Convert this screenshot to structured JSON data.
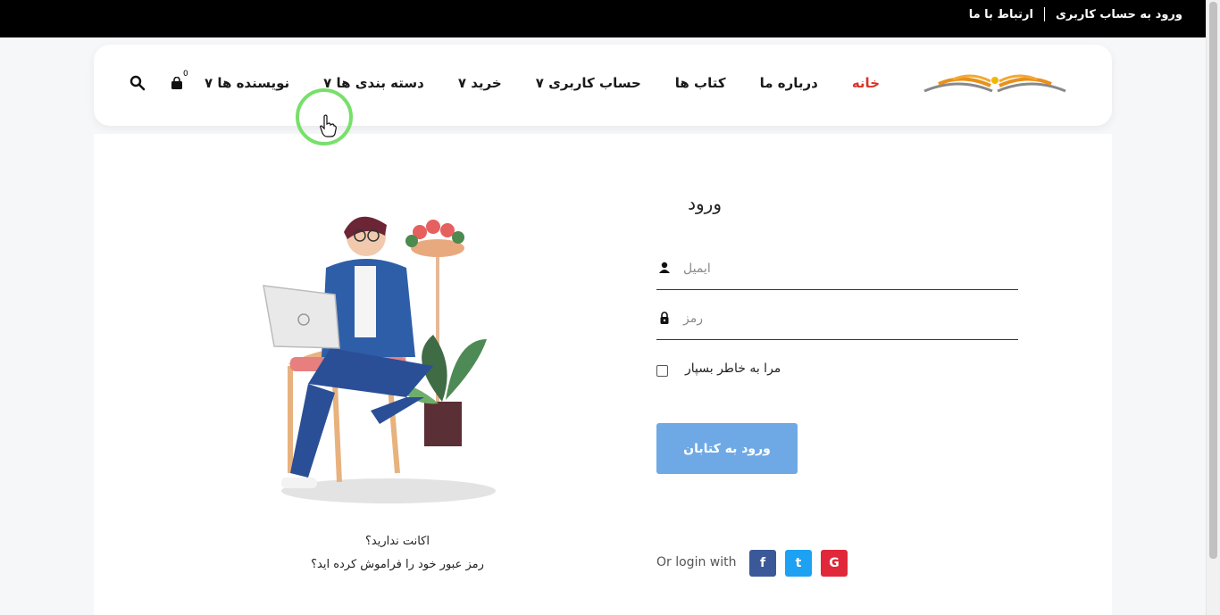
{
  "topbar": {
    "login_link": "ورود به حساب کاربری",
    "contact_link": "ارتباط با ما"
  },
  "nav": {
    "items": [
      {
        "label": "خانه",
        "active": true
      },
      {
        "label": "درباره ما"
      },
      {
        "label": "کتاب ها"
      },
      {
        "label": "حساب کاربری ۷"
      },
      {
        "label": "خرید ۷"
      },
      {
        "label": "دسته بندی ها ۷"
      },
      {
        "label": "نویسنده ها ۷"
      }
    ],
    "cart_count": "0",
    "icons": {
      "cart": "shopping-bag-icon",
      "search": "search-icon"
    }
  },
  "login": {
    "title": "ورود",
    "email_placeholder": "ایمیل",
    "password_placeholder": "رمز",
    "remember_label": "مرا به خاطر بسپار",
    "submit_label": "ورود به کتابان",
    "no_account": "اکانت ندارید؟",
    "forgot_password": "رمز عبور خود را فراموش کرده اید؟"
  },
  "social": {
    "label": "Or login with",
    "facebook": "f",
    "twitter": "t",
    "google": "G"
  },
  "colors": {
    "active_nav": "#d9342b",
    "submit_button": "#6ea9e6",
    "facebook": "#3b5998",
    "twitter": "#1da1f2",
    "google": "#e0283a"
  }
}
